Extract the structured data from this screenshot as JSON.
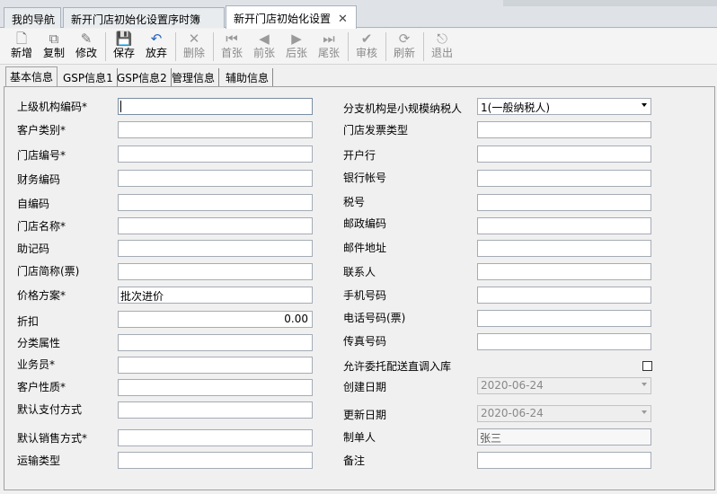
{
  "doc_tabs": [
    {
      "label": "我的导航"
    },
    {
      "label": "新开门店初始化设置序时簿"
    },
    {
      "label": "新开门店初始化设置"
    }
  ],
  "toolbar": {
    "new": "新增",
    "copy": "复制",
    "edit": "修改",
    "save": "保存",
    "abandon": "放弃",
    "delete": "删除",
    "first": "首张",
    "prev": "前张",
    "next": "后张",
    "last": "尾张",
    "audit": "审核",
    "refresh": "刷新",
    "exit": "退出"
  },
  "sub_tabs": [
    "基本信息",
    "GSP信息1",
    "GSP信息2",
    "管理信息",
    "辅助信息"
  ],
  "left_fields": [
    {
      "label": "上级机构编码*",
      "value": ""
    },
    {
      "label": "客户类别*",
      "value": ""
    },
    {
      "label": "门店编号*",
      "value": ""
    },
    {
      "label": "财务编码",
      "value": ""
    },
    {
      "label": "自编码",
      "value": ""
    },
    {
      "label": "门店名称*",
      "value": ""
    },
    {
      "label": "助记码",
      "value": ""
    },
    {
      "label": "门店简称(票)",
      "value": ""
    },
    {
      "label": "价格方案*",
      "value": "批次进价"
    },
    {
      "label": "折扣",
      "value": "0.00"
    },
    {
      "label": "分类属性",
      "value": ""
    },
    {
      "label": "业务员*",
      "value": ""
    },
    {
      "label": "客户性质*",
      "value": ""
    },
    {
      "label": "默认支付方式",
      "value": ""
    },
    {
      "label": "默认销售方式*",
      "value": ""
    },
    {
      "label": "运输类型",
      "value": ""
    }
  ],
  "right_fields": [
    {
      "label": "分支机构是小规模纳税人",
      "value": "1(一般纳税人)"
    },
    {
      "label": "门店发票类型",
      "value": ""
    },
    {
      "label": "开户行",
      "value": ""
    },
    {
      "label": "银行帐号",
      "value": ""
    },
    {
      "label": "税号",
      "value": ""
    },
    {
      "label": "邮政编码",
      "value": ""
    },
    {
      "label": "邮件地址",
      "value": ""
    },
    {
      "label": "联系人",
      "value": ""
    },
    {
      "label": "手机号码",
      "value": ""
    },
    {
      "label": "电话号码(票)",
      "value": ""
    },
    {
      "label": "传真号码",
      "value": ""
    },
    {
      "label": "允许委托配送直调入库",
      "value": ""
    },
    {
      "label": "创建日期",
      "value": "2020-06-24"
    },
    {
      "label": "更新日期",
      "value": "2020-06-24"
    },
    {
      "label": "制单人",
      "value": "张三"
    },
    {
      "label": "备注",
      "value": ""
    }
  ]
}
